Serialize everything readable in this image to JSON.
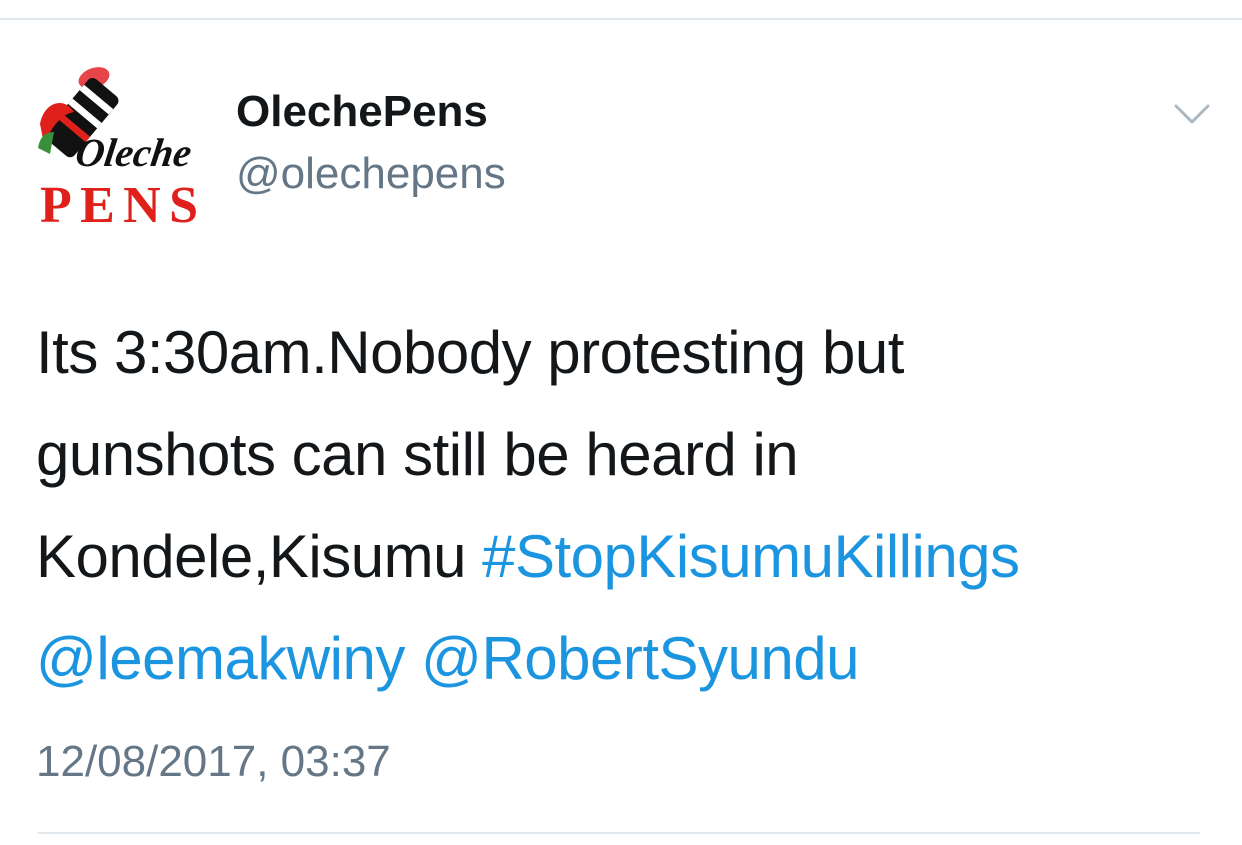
{
  "tweet": {
    "author": {
      "display_name": "OlechePens",
      "handle": "@olechepens",
      "avatar_logo_text_top": "Oleche",
      "avatar_logo_text_bottom": "PENS"
    },
    "text": {
      "line1": "Its 3:30am.Nobody protesting but",
      "line2": "gunshots can still be heard in",
      "line3_plain": "Kondele,Kisumu ",
      "hashtag": "#StopKisumuKillings",
      "mention1": "@leemakwiny",
      "line4_space": " ",
      "mention2": "@RobertSyundu"
    },
    "timestamp": "12/08/2017, 03:37"
  },
  "colors": {
    "link": "#1b95e0",
    "text": "#14171a",
    "secondary": "#657786",
    "divider": "#e1e8ed",
    "logo_red": "#e0201b"
  },
  "icons": {
    "menu": "chevron-down-icon"
  }
}
